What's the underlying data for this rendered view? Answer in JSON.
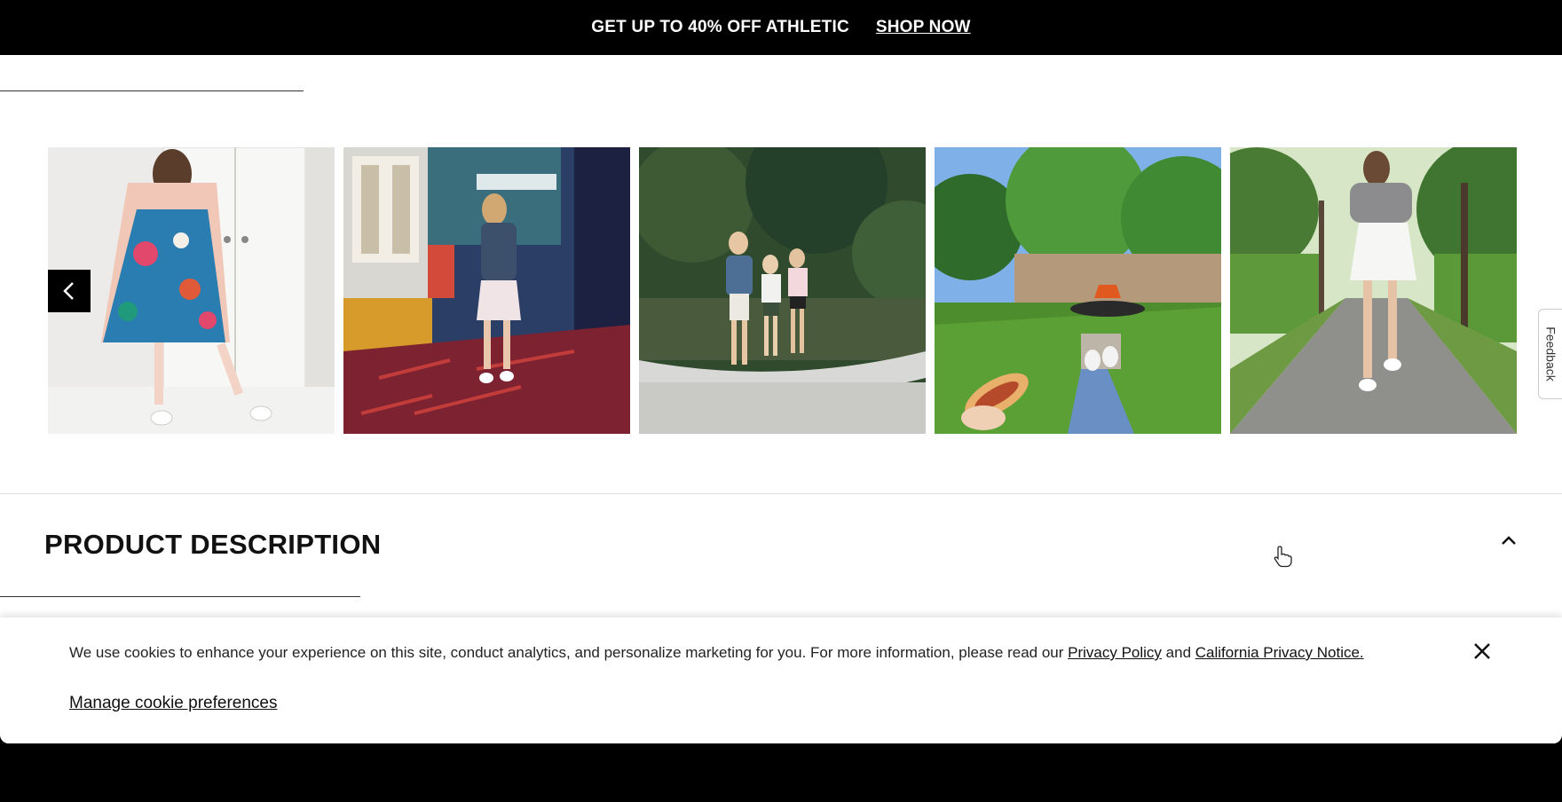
{
  "promo": {
    "text": "GET UP TO 40% OFF ATHLETIC",
    "link": "SHOP NOW"
  },
  "gallery": {
    "prev_icon": "chevron-left-icon",
    "images": [
      {
        "name": "floral-dress-photo"
      },
      {
        "name": "arcade-outfit-photo"
      },
      {
        "name": "family-outdoor-photo"
      },
      {
        "name": "backyard-firepit-photo"
      },
      {
        "name": "woodland-path-photo"
      }
    ]
  },
  "feedback": {
    "label": "Feedback"
  },
  "product_description": {
    "title": "PRODUCT DESCRIPTION",
    "toggle_icon": "chevron-up-icon"
  },
  "cookie_banner": {
    "text_before": "We use cookies to enhance your experience on this site, conduct analytics, and personalize marketing for you. For more information, please read our ",
    "privacy_policy": "Privacy Policy",
    "and": " and ",
    "california_notice": "California Privacy Notice.",
    "manage": "Manage cookie preferences",
    "close_icon": "close-icon"
  },
  "colors": {
    "banner_bg": "#000000",
    "banner_text": "#ffffff",
    "page_bg": "#ffffff"
  }
}
